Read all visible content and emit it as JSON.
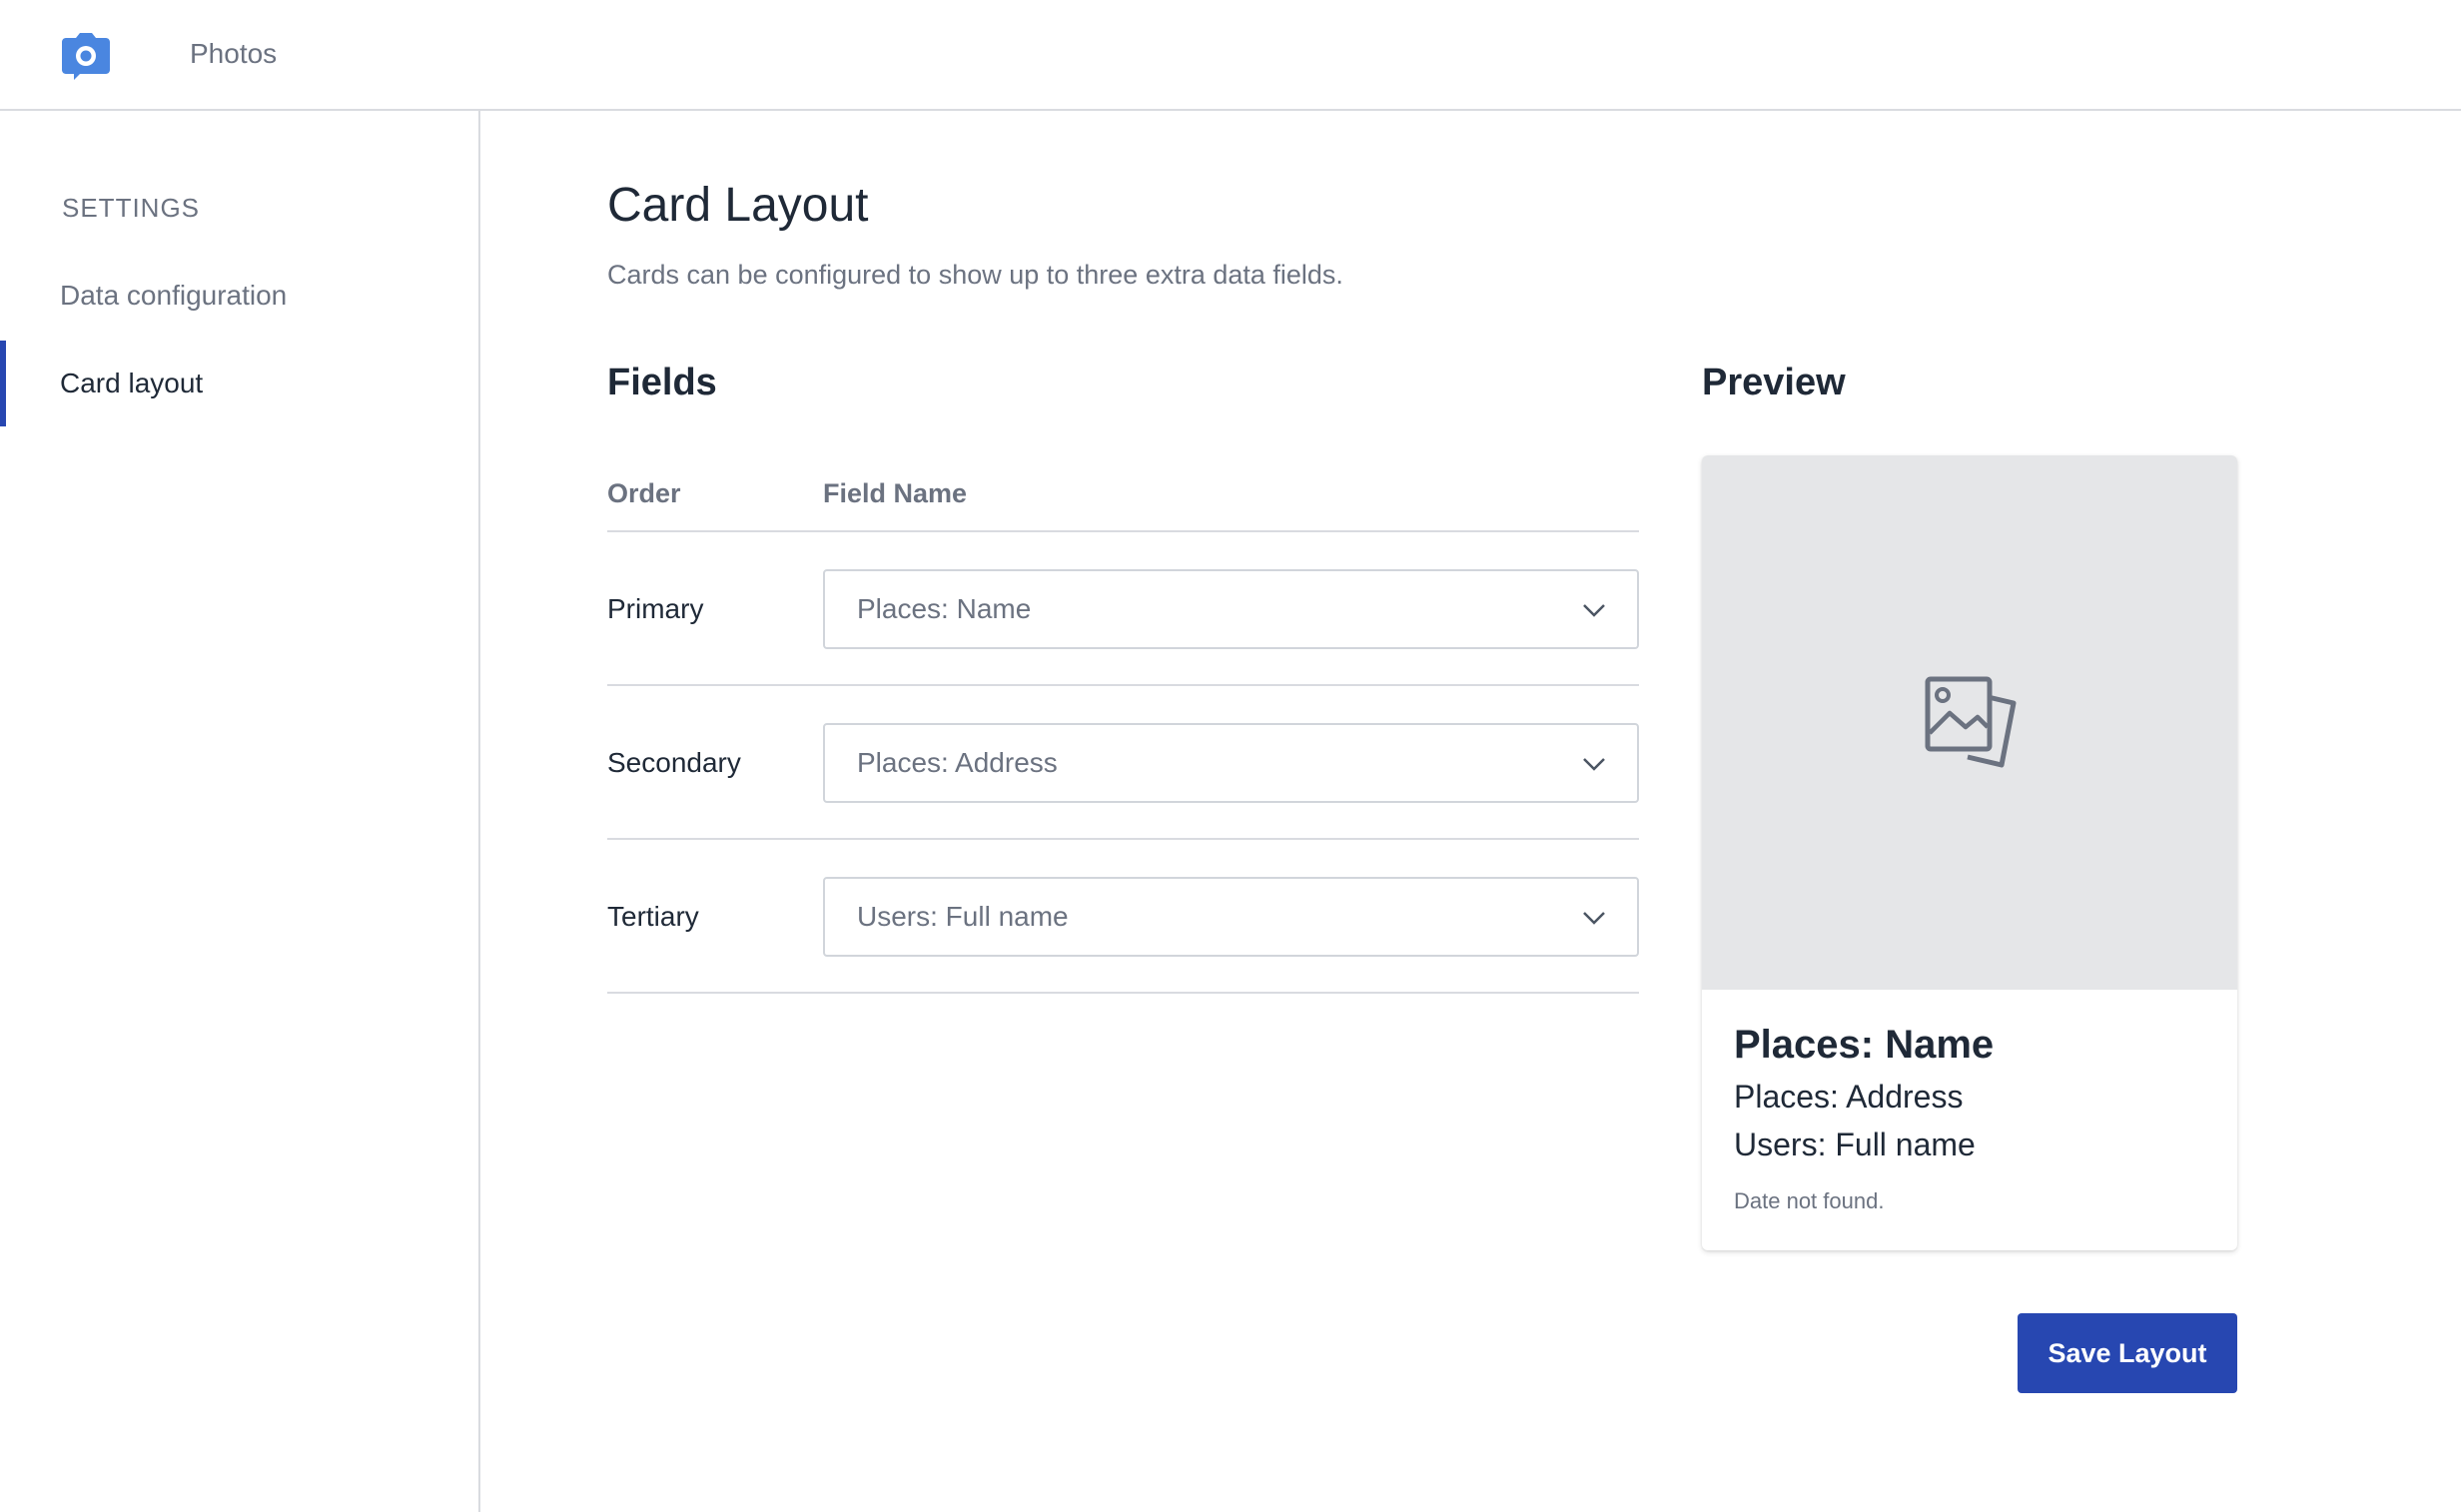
{
  "header": {
    "app_title": "Photos",
    "logo_icon": "camera-icon",
    "accent_color": "#4a86e0"
  },
  "sidebar": {
    "heading": "SETTINGS",
    "items": [
      {
        "label": "Data configuration",
        "active": false
      },
      {
        "label": "Card layout",
        "active": true
      }
    ],
    "active_color": "#2747b1"
  },
  "main": {
    "title": "Card Layout",
    "description": "Cards can be configured to show up to three extra data fields.",
    "fields": {
      "title": "Fields",
      "columns": {
        "order": "Order",
        "field_name": "Field Name"
      },
      "rows": [
        {
          "order": "Primary",
          "value": "Places: Name"
        },
        {
          "order": "Secondary",
          "value": "Places: Address"
        },
        {
          "order": "Tertiary",
          "value": "Users: Full name"
        }
      ]
    },
    "preview": {
      "title": "Preview",
      "image_icon": "image-placeholder-icon",
      "primary": "Places: Name",
      "secondary": "Places: Address",
      "tertiary": "Users: Full name",
      "date": "Date not found."
    },
    "save_label": "Save Layout",
    "button_color": "#2747b1"
  }
}
